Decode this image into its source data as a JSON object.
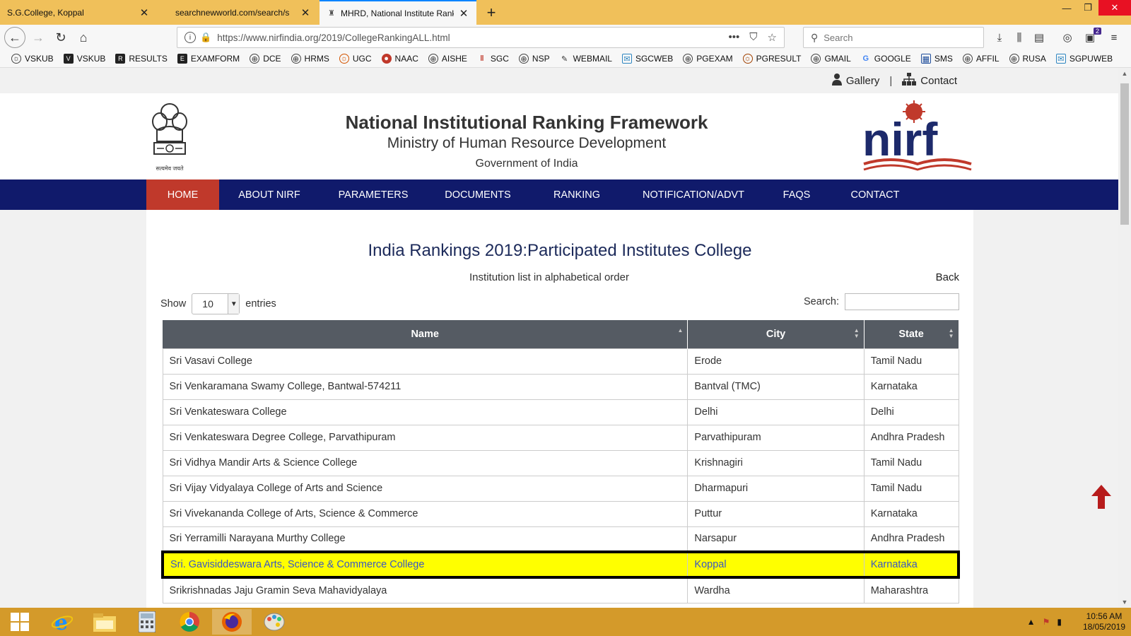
{
  "browser": {
    "tabs": [
      {
        "title": "S.G.College, Koppal",
        "active": false
      },
      {
        "title": "searchnewworld.com/search/s",
        "active": false
      },
      {
        "title": "MHRD, National Institute Ranki",
        "active": true
      }
    ],
    "url": "https://www.nirfindia.org/2019/CollegeRankingALL.html",
    "search_placeholder": "Search",
    "notification_badge": "2",
    "bookmarks": [
      "VSKUB",
      "VSKUB",
      "RESULTS",
      "EXAMFORM",
      "DCE",
      "HRMS",
      "UGC",
      "NAAC",
      "AISHE",
      "SGC",
      "NSP",
      "WEBMAIL",
      "SGCWEB",
      "PGEXAM",
      "PGRESULT",
      "GMAIL",
      "GOOGLE",
      "SMS",
      "AFFIL",
      "RUSA",
      "SGPUWEB"
    ]
  },
  "site": {
    "utility": {
      "gallery": "Gallery",
      "contact": "Contact"
    },
    "title": "National Institutional Ranking Framework",
    "subtitle": "Ministry of Human Resource Development",
    "gov": "Government of India",
    "emblem_motto": "सत्यमेव जयते",
    "logo_text": "nirf",
    "nav": [
      "HOME",
      "ABOUT NIRF",
      "PARAMETERS",
      "DOCUMENTS",
      "RANKING",
      "NOTIFICATION/ADVT",
      "FAQS",
      "CONTACT"
    ]
  },
  "page": {
    "heading": "India Rankings 2019:Participated Institutes College",
    "subheading": "Institution list in alphabetical order",
    "back": "Back",
    "show_label": "Show",
    "entries_value": "10",
    "entries_label": "entries",
    "search_label": "Search:",
    "table": {
      "headers": [
        "Name",
        "City",
        "State"
      ],
      "rows": [
        [
          "Sri Vasavi College",
          "Erode",
          "Tamil Nadu"
        ],
        [
          "Sri Venkaramana Swamy College, Bantwal-574211",
          "Bantval (TMC)",
          "Karnataka"
        ],
        [
          "Sri Venkateswara College",
          "Delhi",
          "Delhi"
        ],
        [
          "Sri Venkateswara Degree College, Parvathipuram",
          "Parvathipuram",
          "Andhra Pradesh"
        ],
        [
          "Sri Vidhya Mandir Arts & Science College",
          "Krishnagiri",
          "Tamil Nadu"
        ],
        [
          "Sri Vijay Vidyalaya College of Arts and Science",
          "Dharmapuri",
          "Tamil Nadu"
        ],
        [
          "Sri Vivekananda College of Arts, Science & Commerce",
          "Puttur",
          "Karnataka"
        ],
        [
          "Sri Yerramilli Narayana Murthy College",
          "Narsapur",
          "Andhra Pradesh"
        ],
        [
          "Sri. Gavisiddeswara Arts, Science & Commerce College",
          "Koppal",
          "Karnataka"
        ],
        [
          "Srikrishnadas Jaju Gramin Seva Mahavidyalaya",
          "Wardha",
          "Maharashtra"
        ]
      ],
      "highlighted_row": 8
    }
  },
  "taskbar": {
    "time": "10:56 AM",
    "date": "18/05/2019"
  },
  "colors": {
    "nav_bg": "#101a6b",
    "nav_active": "#c0392b",
    "tab_bar": "#f0c05a",
    "highlight": "#ffff00",
    "taskbar": "#d49a2a"
  }
}
